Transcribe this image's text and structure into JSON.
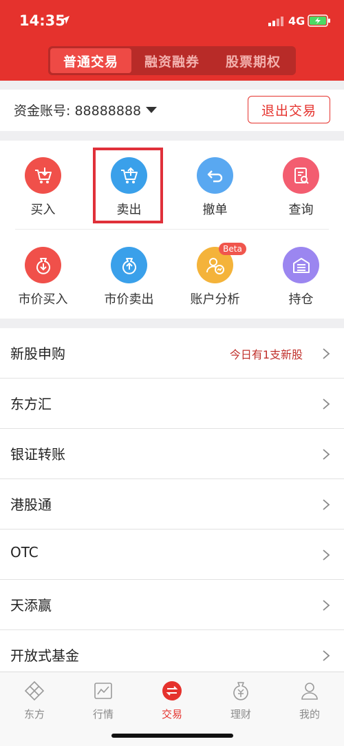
{
  "status_bar": {
    "time": "14:35",
    "network": "4G"
  },
  "header": {
    "tabs": [
      {
        "label": "普通交易",
        "active": true
      },
      {
        "label": "融资融券",
        "active": false
      },
      {
        "label": "股票期权",
        "active": false
      }
    ]
  },
  "account": {
    "label": "资金账号: 88888888",
    "logout_label": "退出交易"
  },
  "actions": [
    {
      "label": "买入",
      "icon": "cart-down-icon",
      "color": "#f0504a"
    },
    {
      "label": "卖出",
      "icon": "cart-up-icon",
      "color": "#3aa0ea"
    },
    {
      "label": "撤单",
      "icon": "undo-icon",
      "color": "#59a8f1"
    },
    {
      "label": "查询",
      "icon": "search-doc-icon",
      "color": "#f35d70"
    },
    {
      "label": "市价买入",
      "icon": "moneybag-down-icon",
      "color": "#f0504a"
    },
    {
      "label": "市价卖出",
      "icon": "moneybag-up-icon",
      "color": "#3aa0ea"
    },
    {
      "label": "账户分析",
      "icon": "user-chart-icon",
      "color": "#f4b33a",
      "badge": "Beta"
    },
    {
      "label": "持仓",
      "icon": "warehouse-icon",
      "color": "#9b86f0"
    }
  ],
  "menu": [
    {
      "label": "新股申购",
      "note": "今日有1支新股"
    },
    {
      "label": "东方汇"
    },
    {
      "label": "银证转账"
    },
    {
      "label": "港股通"
    },
    {
      "label": "OTC"
    },
    {
      "label": "天添赢"
    },
    {
      "label": "开放式基金"
    }
  ],
  "tabbar": [
    {
      "label": "东方",
      "icon": "diamond-logo-icon"
    },
    {
      "label": "行情",
      "icon": "chart-icon"
    },
    {
      "label": "交易",
      "icon": "exchange-icon",
      "active": true
    },
    {
      "label": "理财",
      "icon": "moneybag-icon"
    },
    {
      "label": "我的",
      "icon": "user-icon"
    }
  ],
  "colors": {
    "brand": "#e5322d",
    "highlight": "#e0303a"
  }
}
